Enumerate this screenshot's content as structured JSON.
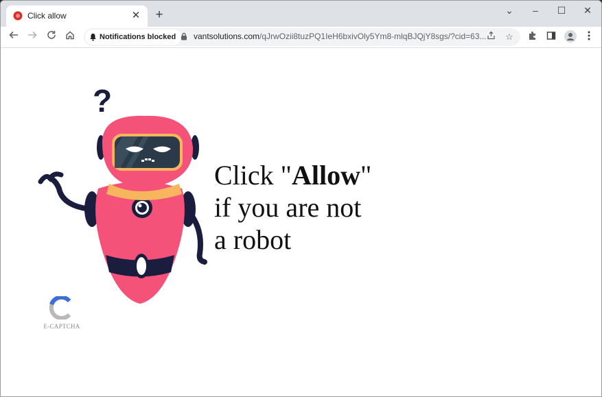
{
  "browser": {
    "tab": {
      "title": "Click allow"
    },
    "new_tab_symbol": "+",
    "window_controls": {
      "minimize": "–",
      "maximize": "☐",
      "close": "✕",
      "dropdown": "⌄"
    },
    "omnibox": {
      "notification_chip": "Notifications blocked",
      "url_host": "vantsolutions.com",
      "url_path": "/qJrwOzii8tuzPQ1IeH6bxivOly5Ym8-mlqBJQjY8sgs/?cid=63..."
    }
  },
  "page": {
    "headline": {
      "line1_prefix": "Click \"",
      "line1_bold": "Allow",
      "line1_suffix": "\"",
      "line2": "if you are not",
      "line3": "a robot"
    },
    "question_mark": "?",
    "captcha_label": "E-CAPTCHA"
  },
  "colors": {
    "robot_body": "#f5527a",
    "robot_dark": "#1b1d3f",
    "robot_collar": "#f7b55e",
    "visor": "#2b3a48",
    "captcha_blue": "#3b6fd6",
    "captcha_gray": "#b9b9b9"
  }
}
